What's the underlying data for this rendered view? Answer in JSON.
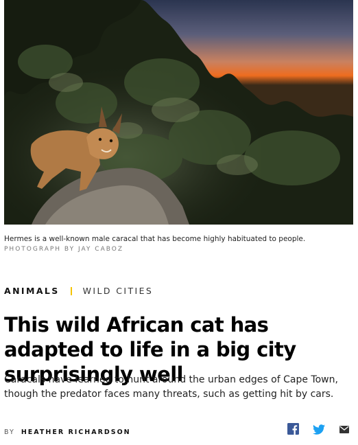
{
  "photo": {
    "alt": "Caracal at dusk in fynbos",
    "caption": "Hermes is a well-known male caracal that has become highly habituated to people.",
    "credit": "PHOTOGRAPH BY JAY CABOZ"
  },
  "kicker": {
    "category": "ANIMALS",
    "series": "WILD CITIES",
    "separator_color": "#f5c400"
  },
  "headline": "This wild African cat has adapted to life in a big city surprisingly well",
  "dek": "Caracals have learned to hunt around the urban edges of Cape Town, though the predator faces many threats, such as getting hit by cars.",
  "byline": {
    "prefix": "BY",
    "author": "HEATHER RICHARDSON"
  },
  "share": {
    "icons": [
      "facebook-icon",
      "twitter-icon",
      "email-icon"
    ],
    "facebook_color": "#3b5998",
    "twitter_color": "#1da1f2",
    "email_color": "#333333"
  }
}
